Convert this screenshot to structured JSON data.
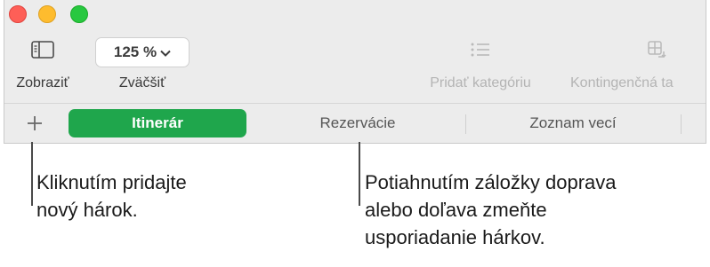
{
  "window": {
    "traffic_lights": [
      "close",
      "minimize",
      "zoom"
    ]
  },
  "toolbar": {
    "view": {
      "label": "Zobraziť",
      "icon": "sidebar-icon"
    },
    "zoom": {
      "value": "125 %",
      "label": "Zväčšiť",
      "icon": "chevron-down-icon"
    },
    "add_category": {
      "label": "Pridať kategóriu",
      "icon": "list-icon",
      "enabled": false
    },
    "pivot": {
      "label": "Kontingenčná ta",
      "icon": "pivot-table-icon",
      "enabled": false
    }
  },
  "tabbar": {
    "add_sheet": "+",
    "tabs": [
      {
        "label": "Itinerár",
        "active": true
      },
      {
        "label": "Rezervácie",
        "active": false
      },
      {
        "label": "Zoznam vecí",
        "active": false
      }
    ],
    "accent_color": "#1fa64c"
  },
  "callouts": {
    "add_sheet": {
      "line1": "Kliknutím pridajte",
      "line2": "nový hárok."
    },
    "reorder": {
      "line1": "Potiahnutím záložky doprava",
      "line2": "alebo doľava zmeňte",
      "line3": "usporiadanie hárkov."
    }
  }
}
